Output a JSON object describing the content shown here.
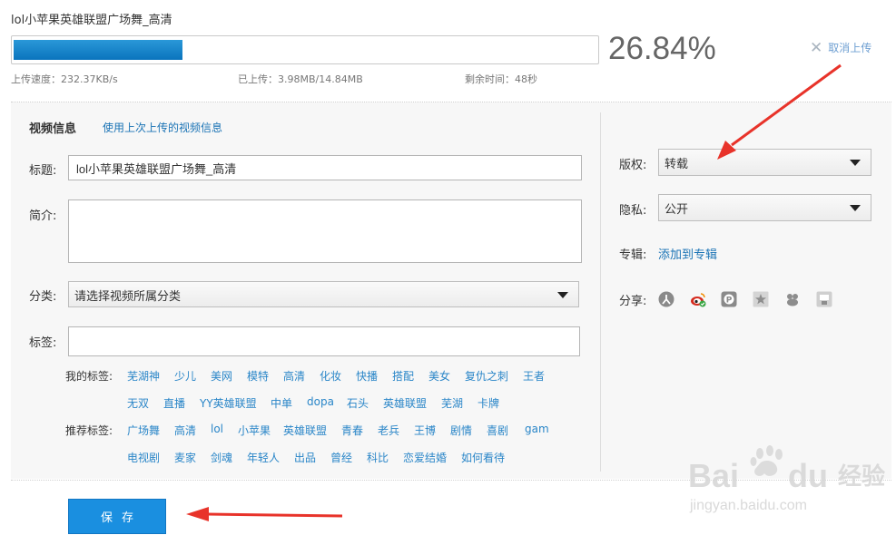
{
  "upload": {
    "filename": "lol小苹果英雄联盟广场舞_高清",
    "progress_percent": 26.84,
    "percent_text": "26.84%",
    "cancel_label": "取消上传",
    "speed": "上传速度：232.37KB/s",
    "uploaded": "已上传：3.98MB/14.84MB",
    "remaining": "剩余时间：48秒"
  },
  "video_info": {
    "section_title": "视频信息",
    "reuse_link": "使用上次上传的视频信息",
    "title_label": "标题:",
    "title_value": "lol小苹果英雄联盟广场舞_高清",
    "intro_label": "简介:",
    "category_label": "分类:",
    "category_value": "请选择视频所属分类",
    "tags_label": "标签:"
  },
  "my_tags": {
    "label": "我的标签:",
    "row1": [
      "芜湖神",
      "少儿",
      "美网",
      "模特",
      "高清",
      "化妆",
      "快播",
      "搭配",
      "美女",
      "复仇之刺",
      "王者"
    ],
    "row2": [
      "无双",
      "直播",
      "YY英雄联盟",
      "中单",
      "dopa",
      "石头",
      "英雄联盟",
      "芜湖",
      "卡牌"
    ]
  },
  "recommended_tags": {
    "label": "推荐标签:",
    "row1": [
      "广场舞",
      "高清",
      "lol",
      "小苹果",
      "英雄联盟",
      "青春",
      "老兵",
      "王博",
      "剧情",
      "喜剧",
      "gam"
    ],
    "row2": [
      "电视剧",
      "麦家",
      "剑魂",
      "年轻人",
      "出品",
      "曾经",
      "科比",
      "恋爱结婚",
      "如何看待"
    ]
  },
  "settings": {
    "copyright_label": "版权:",
    "copyright_value": "转载",
    "privacy_label": "隐私:",
    "privacy_value": "公开",
    "album_label": "专辑:",
    "album_link": "添加到专辑",
    "share_label": "分享:",
    "share_icons": [
      "renren-icon",
      "weibo-icon",
      "kaixin-icon",
      "qzone-star-icon",
      "tencent-weibo-icon",
      "douban-icon"
    ]
  },
  "actions": {
    "save_label": "保存"
  },
  "watermark": {
    "brand": "Bai du 经验",
    "url": "jingyan.baidu.com"
  },
  "colors": {
    "accent": "#1a8fe0",
    "link": "#2a86c8",
    "annotation_arrow": "#e8332a"
  }
}
